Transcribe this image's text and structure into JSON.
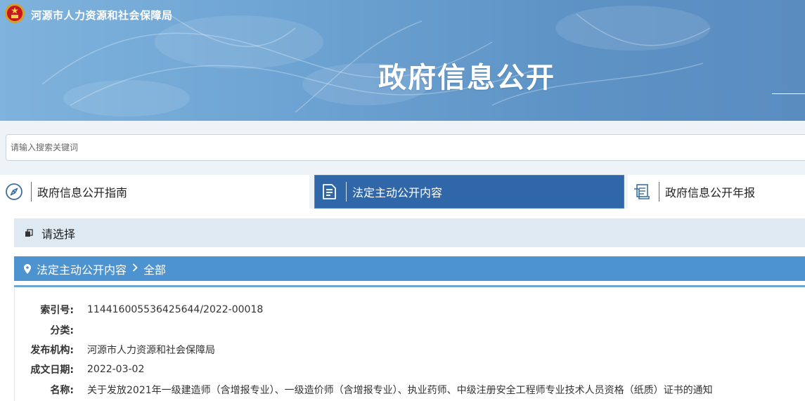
{
  "header": {
    "agency_name": "河源市人力资源和社会保障局",
    "title": "政府信息公开"
  },
  "search": {
    "placeholder": "请输入搜索关键词"
  },
  "tabs": [
    {
      "label": "政府信息公开指南",
      "icon": "compass-icon",
      "active": false
    },
    {
      "label": "法定主动公开内容",
      "icon": "document-icon",
      "active": true
    },
    {
      "label": "政府信息公开年报",
      "icon": "report-icon",
      "active": false
    }
  ],
  "select": {
    "label": "请选择"
  },
  "breadcrumb": {
    "section": "法定主动公开内容",
    "current": "全部"
  },
  "meta": {
    "index_label": "索引号:",
    "index_value": "114416005536425644/2022-00018",
    "category_label": "分类:",
    "category_value": "",
    "publisher_label": "发布机构:",
    "publisher_value": "河源市人力资源和社会保障局",
    "date_label": "成文日期:",
    "date_value": "2022-03-02",
    "name_label": "名称:",
    "name_value": "关于发放2021年一级建造师（含增报专业）、一级造价师（含增报专业）、执业药师、中级注册安全工程师专业技术人员资格（纸质）证书的通知"
  },
  "colors": {
    "banner": "#6ea4d3",
    "active_tab": "#2f67a8",
    "breadcrumb": "#4c93cf",
    "select_bar": "#dfe9f2"
  }
}
